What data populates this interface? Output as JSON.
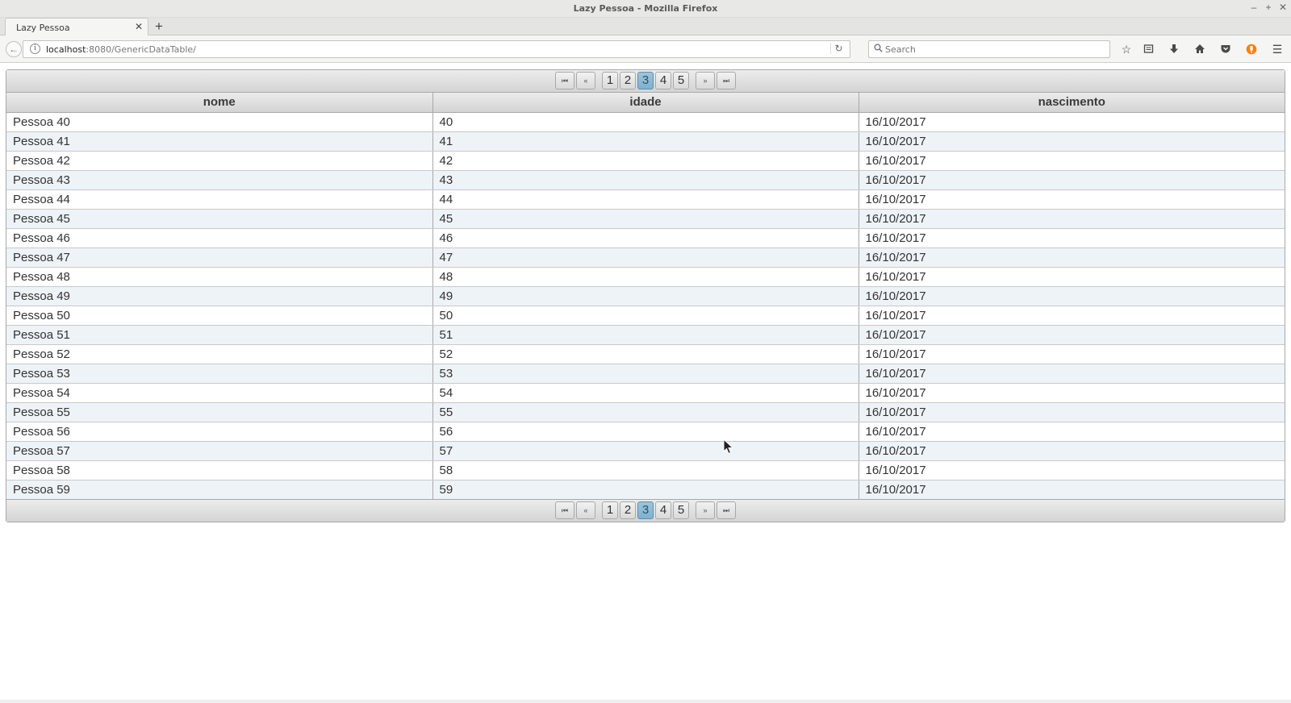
{
  "window": {
    "title": "Lazy Pessoa - Mozilla Firefox",
    "controls": [
      "–",
      "+",
      "✕"
    ]
  },
  "tabs": [
    {
      "label": "Lazy Pessoa",
      "close": "✕"
    }
  ],
  "new_tab": "+",
  "navbar": {
    "back": "←",
    "url_host": "localhost",
    "url_rest": ":8080/GenericDataTable/",
    "reload": "↻",
    "search_placeholder": "Search",
    "icons": [
      "star-icon",
      "reading-list-icon",
      "download-icon",
      "home-icon",
      "pocket-icon",
      "extension-icon",
      "menu-icon"
    ]
  },
  "paginator": {
    "first": "⏮",
    "prev": "«",
    "next": "»",
    "last": "⏭",
    "pages": [
      "1",
      "2",
      "3",
      "4",
      "5"
    ],
    "current_page": "3"
  },
  "table": {
    "columns": [
      "nome",
      "idade",
      "nascimento"
    ],
    "rows": [
      [
        "Pessoa 40",
        "40",
        "16/10/2017"
      ],
      [
        "Pessoa 41",
        "41",
        "16/10/2017"
      ],
      [
        "Pessoa 42",
        "42",
        "16/10/2017"
      ],
      [
        "Pessoa 43",
        "43",
        "16/10/2017"
      ],
      [
        "Pessoa 44",
        "44",
        "16/10/2017"
      ],
      [
        "Pessoa 45",
        "45",
        "16/10/2017"
      ],
      [
        "Pessoa 46",
        "46",
        "16/10/2017"
      ],
      [
        "Pessoa 47",
        "47",
        "16/10/2017"
      ],
      [
        "Pessoa 48",
        "48",
        "16/10/2017"
      ],
      [
        "Pessoa 49",
        "49",
        "16/10/2017"
      ],
      [
        "Pessoa 50",
        "50",
        "16/10/2017"
      ],
      [
        "Pessoa 51",
        "51",
        "16/10/2017"
      ],
      [
        "Pessoa 52",
        "52",
        "16/10/2017"
      ],
      [
        "Pessoa 53",
        "53",
        "16/10/2017"
      ],
      [
        "Pessoa 54",
        "54",
        "16/10/2017"
      ],
      [
        "Pessoa 55",
        "55",
        "16/10/2017"
      ],
      [
        "Pessoa 56",
        "56",
        "16/10/2017"
      ],
      [
        "Pessoa 57",
        "57",
        "16/10/2017"
      ],
      [
        "Pessoa 58",
        "58",
        "16/10/2017"
      ],
      [
        "Pessoa 59",
        "59",
        "16/10/2017"
      ]
    ]
  }
}
